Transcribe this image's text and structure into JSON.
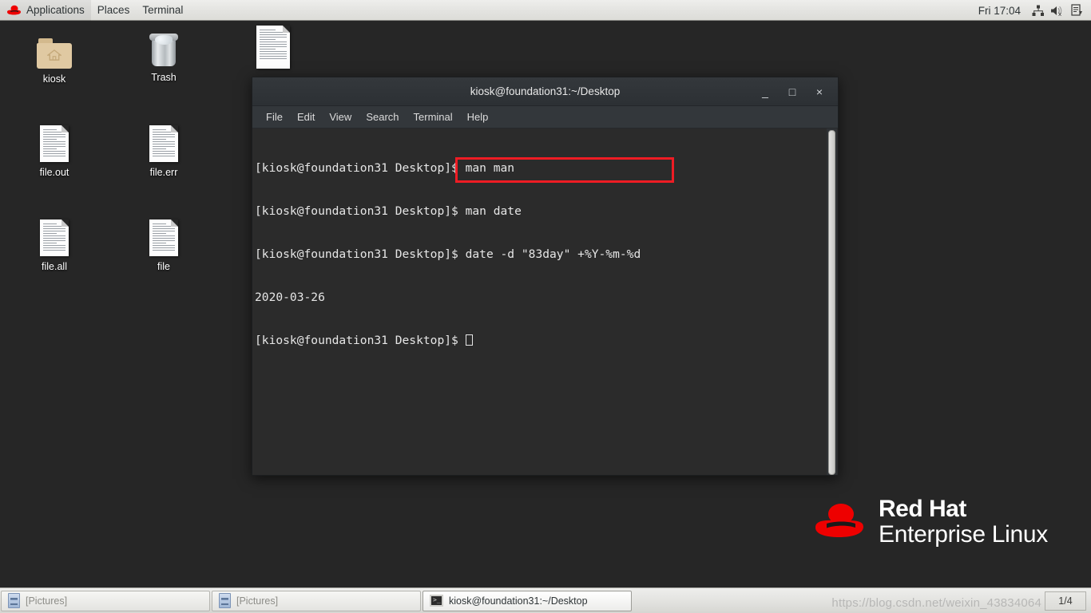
{
  "top_panel": {
    "logo_icon": "redhat-fedora-icon",
    "menus": [
      {
        "label": "Applications",
        "name": "applications-menu"
      },
      {
        "label": "Places",
        "name": "places-menu"
      },
      {
        "label": "Terminal",
        "name": "terminal-menu"
      }
    ],
    "clock": "Fri 17:04",
    "tray": [
      {
        "name": "network-icon",
        "icon": "network-wired-icon"
      },
      {
        "name": "volume-muted-icon",
        "icon": "speaker-muted-icon"
      },
      {
        "name": "software-update-icon",
        "icon": "document-update-icon"
      }
    ]
  },
  "desktop": {
    "background_color": "#262626",
    "icons": [
      {
        "name": "desktop-icon-kiosk",
        "label": "kiosk",
        "type": "home-folder-icon"
      },
      {
        "name": "desktop-icon-trash",
        "label": "Trash",
        "type": "trash-icon"
      },
      {
        "name": "desktop-icon-file-out",
        "label": "file.out",
        "type": "document-icon"
      },
      {
        "name": "desktop-icon-file-err",
        "label": "file.err",
        "type": "document-icon"
      },
      {
        "name": "desktop-icon-file-all",
        "label": "file.all",
        "type": "document-icon"
      },
      {
        "name": "desktop-icon-file",
        "label": "file",
        "type": "document-icon"
      },
      {
        "name": "desktop-icon-unlabeled",
        "label": "",
        "type": "document-icon"
      }
    ]
  },
  "terminal": {
    "title": "kiosk@foundation31:~/Desktop",
    "window_buttons": {
      "minimize": "_",
      "maximize": "□",
      "close": "×"
    },
    "menubar": [
      "File",
      "Edit",
      "View",
      "Search",
      "Terminal",
      "Help"
    ],
    "prompt": "[kiosk@foundation31 Desktop]$ ",
    "lines": [
      "[kiosk@foundation31 Desktop]$ man man",
      "[kiosk@foundation31 Desktop]$ man date",
      "[kiosk@foundation31 Desktop]$ date -d \"83day\" +%Y-%m-%d",
      "2020-03-26"
    ],
    "last_prompt": "[kiosk@foundation31 Desktop]$ ",
    "highlight": {
      "name": "red-highlight-box",
      "color": "#ee1c24",
      "target_text": "date -d \"83day\" +%Y-%m-%d"
    },
    "background_color": "#2b2b2b",
    "foreground_color": "#e6e6e6"
  },
  "brand": {
    "line1": "Red Hat",
    "line2": "Enterprise Linux",
    "logo_color": "#ee0000"
  },
  "bottom_panel": {
    "tasks": [
      {
        "name": "taskbar-item-pictures-1",
        "label": "[Pictures]",
        "icon": "file-manager-icon",
        "active": false
      },
      {
        "name": "taskbar-item-pictures-2",
        "label": "[Pictures]",
        "icon": "file-manager-icon",
        "active": false
      },
      {
        "name": "taskbar-item-terminal",
        "label": "kiosk@foundation31:~/Desktop",
        "icon": "terminal-icon",
        "active": true
      }
    ],
    "workspace": "1/4",
    "watermark": "https://blog.csdn.net/weixin_43834064"
  }
}
